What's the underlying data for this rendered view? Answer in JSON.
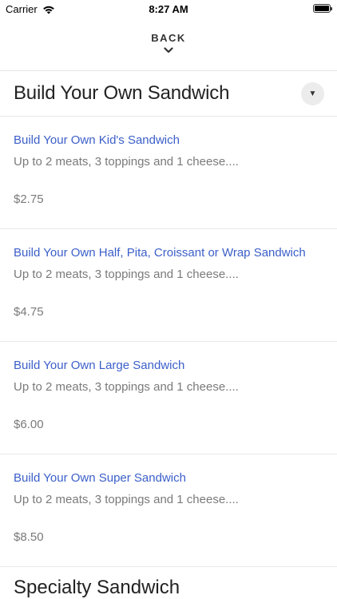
{
  "status_bar": {
    "carrier": "Carrier",
    "time": "8:27 AM"
  },
  "nav": {
    "back_label": "BACK"
  },
  "section": {
    "title": "Build Your Own Sandwich",
    "items": [
      {
        "name": "Build Your Own Kid's Sandwich",
        "description": "Up to 2 meats, 3 toppings and 1 cheese....",
        "price": "$2.75"
      },
      {
        "name": "Build Your Own Half, Pita, Croissant or Wrap Sandwich",
        "description": "Up to 2 meats, 3 toppings and 1 cheese....",
        "price": "$4.75"
      },
      {
        "name": "Build Your Own Large Sandwich",
        "description": "Up to 2 meats, 3 toppings and 1 cheese....",
        "price": "$6.00"
      },
      {
        "name": "Build Your Own Super Sandwich",
        "description": "Up to 2 meats, 3 toppings and 1 cheese....",
        "price": "$8.50"
      }
    ]
  },
  "next_section": {
    "title": "Specialty Sandwich"
  },
  "colors": {
    "item_name": "#3b5fc9",
    "secondary_text": "#7a7a7a",
    "title_text": "#222222",
    "divider": "#e8e8e8",
    "toggle_bg": "#ececec"
  },
  "icons": {
    "wifi": "wifi-icon",
    "battery": "battery-icon",
    "back_chevron": "chevron-down-icon",
    "collapse_toggle": "caret-down-icon"
  }
}
